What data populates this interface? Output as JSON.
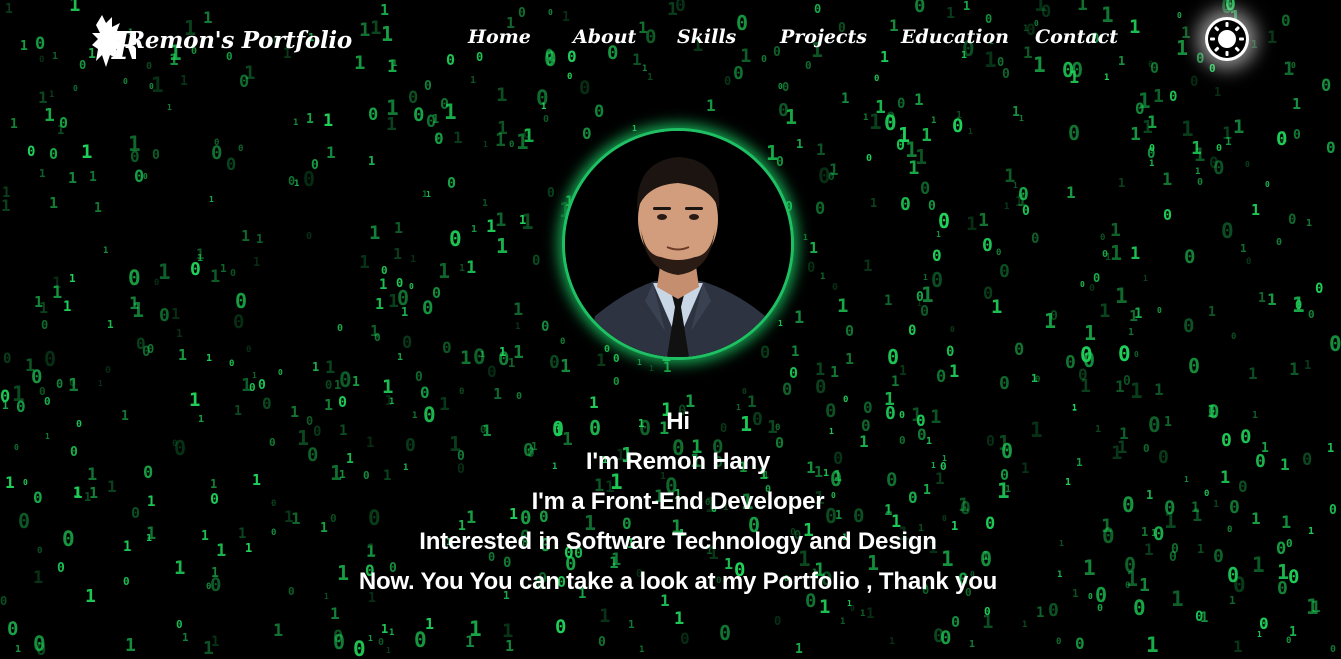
{
  "brand": {
    "name": "Remon's Portfolio"
  },
  "nav": {
    "items": [
      {
        "label": "Home"
      },
      {
        "label": "About"
      },
      {
        "label": "Skills"
      },
      {
        "label": "Projects"
      },
      {
        "label": "Education"
      },
      {
        "label": "Contact"
      }
    ]
  },
  "theme_toggle": {
    "icon": "sun-icon"
  },
  "hero": {
    "avatar_icon": "profile-photo",
    "lines": [
      "Hi",
      "I'm Remon Hany",
      "I'm a Front-End Developer",
      "Interested in Software Technology and Design",
      "Now. You You can take a look at my Portfolio , Thank you"
    ]
  },
  "colors": {
    "background": "#000000",
    "matrix_green": "#1fd35a",
    "avatar_ring": "#1fbf63",
    "text": "#ffffff"
  }
}
